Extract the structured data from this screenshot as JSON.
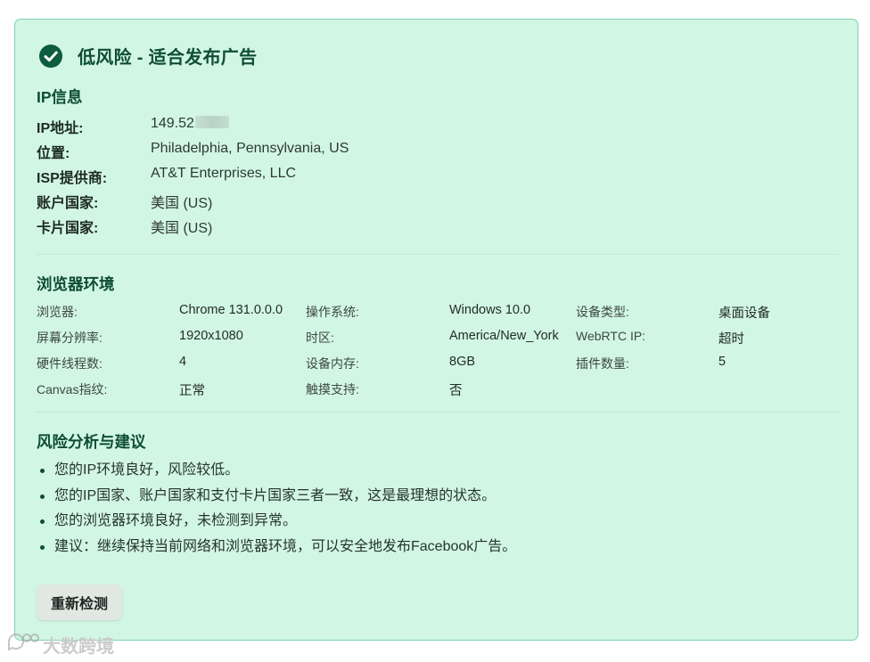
{
  "header": {
    "title": "低风险 - 适合发布广告",
    "icon": "check-circle-icon",
    "accent": "#0e5c3f"
  },
  "ip_info": {
    "title": "IP信息",
    "rows": [
      {
        "label": "IP地址:",
        "value": "149.52"
      },
      {
        "label": "位置:",
        "value": "Philadelphia, Pennsylvania, US"
      },
      {
        "label": "ISP提供商:",
        "value": "AT&T Enterprises, LLC"
      },
      {
        "label": "账户国家:",
        "value": "美国 (US)"
      },
      {
        "label": "卡片国家:",
        "value": "美国 (US)"
      }
    ]
  },
  "browser_env": {
    "title": "浏览器环境",
    "rows": [
      [
        {
          "label": "浏览器:",
          "value": "Chrome 131.0.0.0"
        },
        {
          "label": "操作系统:",
          "value": "Windows 10.0"
        },
        {
          "label": "设备类型:",
          "value": "桌面设备"
        }
      ],
      [
        {
          "label": "屏幕分辨率:",
          "value": "1920x1080"
        },
        {
          "label": "时区:",
          "value": "America/New_York"
        },
        {
          "label": "WebRTC IP:",
          "value": "超时"
        }
      ],
      [
        {
          "label": "硬件线程数:",
          "value": "4"
        },
        {
          "label": "设备内存:",
          "value": "8GB"
        },
        {
          "label": "插件数量:",
          "value": "5"
        }
      ],
      [
        {
          "label": "Canvas指纹:",
          "value": "正常"
        },
        {
          "label": "触摸支持:",
          "value": "否"
        }
      ]
    ]
  },
  "risk": {
    "title": "风险分析与建议",
    "items": [
      "您的IP环境良好，风险较低。",
      "您的IP国家、账户国家和支付卡片国家三者一致，这是最理想的状态。",
      "您的浏览器环境良好，未检测到异常。",
      "建议：继续保持当前网络和浏览器环境，可以安全地发布Facebook广告。"
    ]
  },
  "actions": {
    "recheck_label": "重新检测"
  },
  "watermark": {
    "text": "大数跨境",
    "icon": "chat-bubble-icon"
  },
  "colors": {
    "card_bg": "#d2f6e4",
    "card_border": "#7fd3a9",
    "title": "#0e4d36"
  }
}
